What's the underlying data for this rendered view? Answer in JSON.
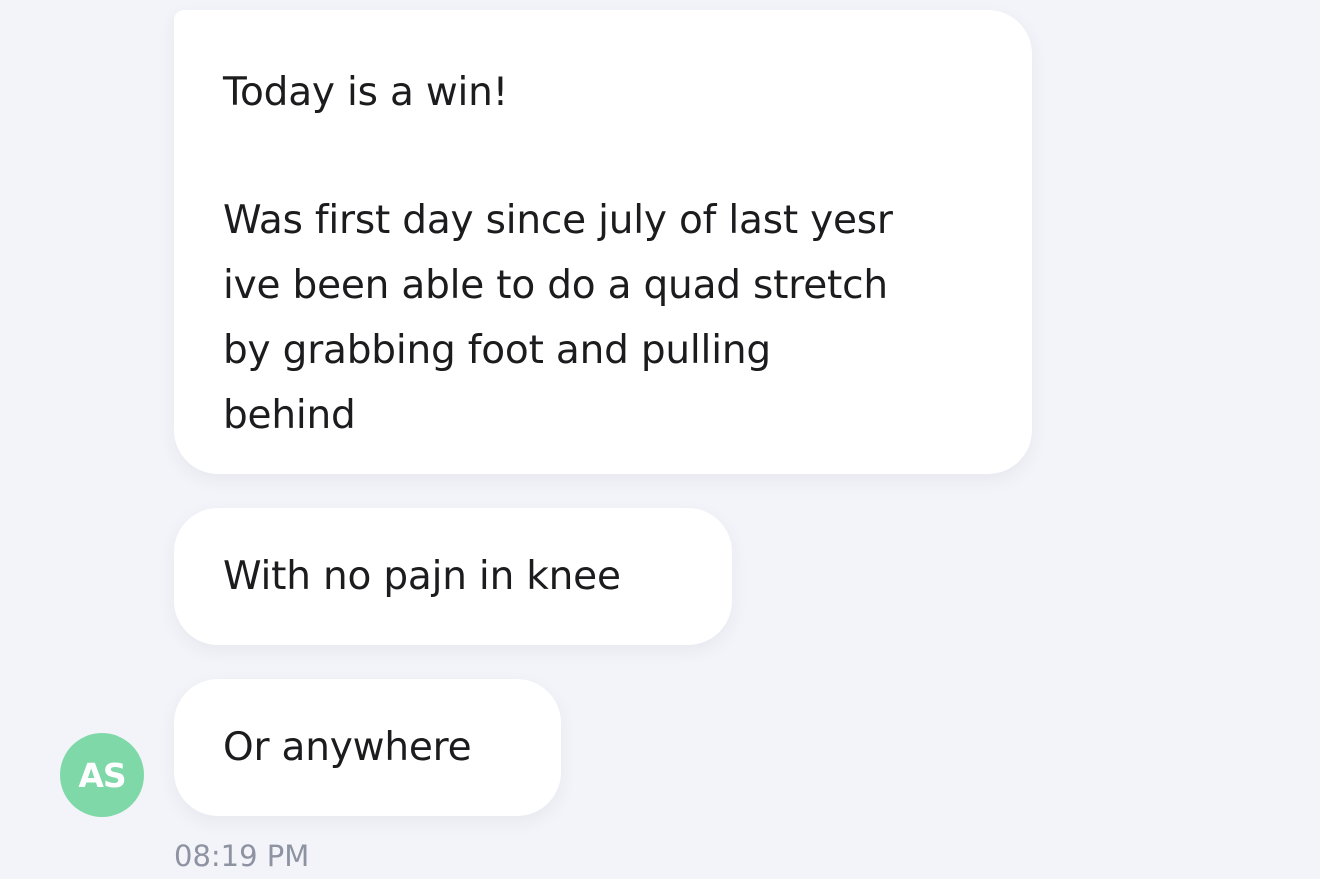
{
  "conversation": {
    "messages": [
      {
        "lines": [
          "Today is a win!",
          "",
          "Was first day since july of last yesr",
          "ive been able to do a quad stretch",
          "by grabbing foot and pulling",
          "behind"
        ]
      },
      {
        "text": "With no pajn in knee"
      },
      {
        "text": "Or anywhere"
      }
    ],
    "sender_initials": "AS",
    "timestamp": "08:19 PM"
  },
  "colors": {
    "background": "#f3f4f9",
    "bubble": "#ffffff",
    "avatar": "#7fd8a8",
    "timestamp": "#8e93a2"
  }
}
